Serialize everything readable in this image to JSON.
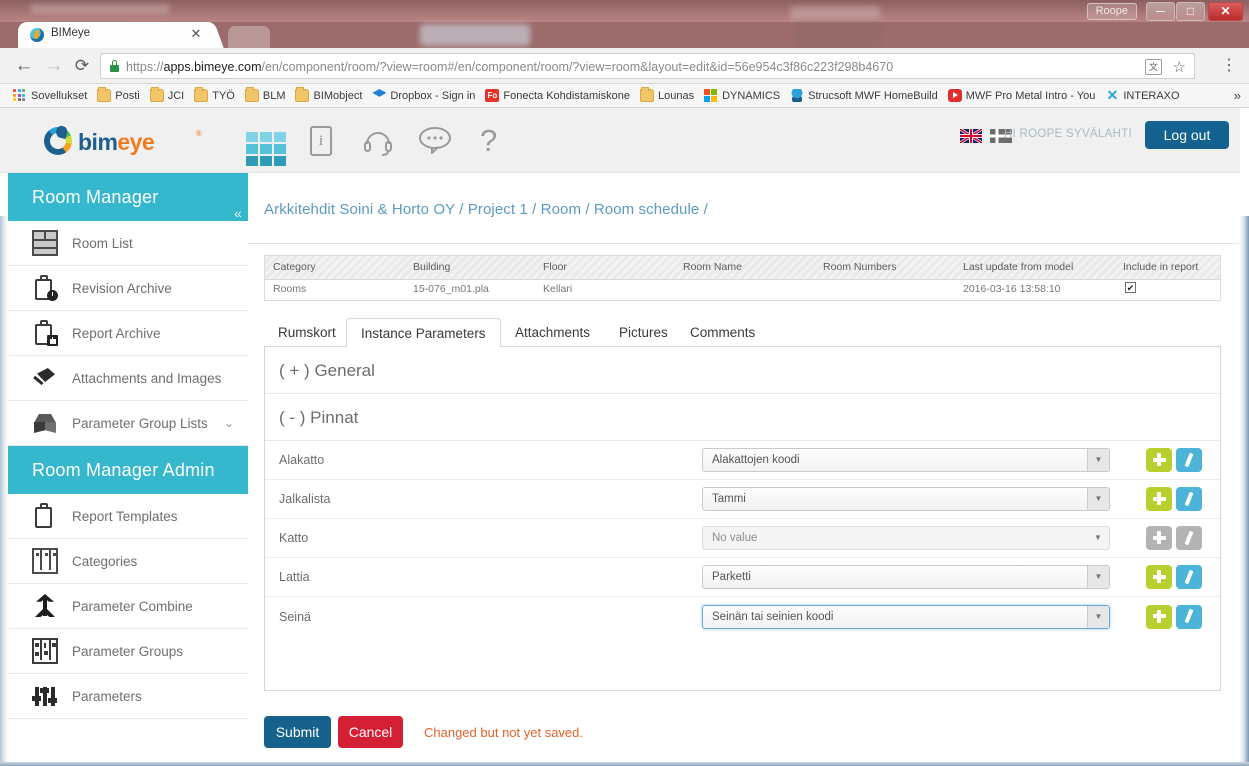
{
  "browser": {
    "tab": {
      "title": "BIMeye",
      "close_label": "✕"
    },
    "window_controls": {
      "user": "Roope",
      "minimize": "─",
      "maximize": "□",
      "close": "✕"
    },
    "nav": {
      "back": "←",
      "forward": "→",
      "reload": "⟳"
    },
    "omnibox": {
      "scheme": "https://",
      "host": "apps.bimeye.com",
      "path": "/en/component/room/?view=room#/en/component/room/?view=room&layout=edit&id=56e954c3f86c223f298b4670",
      "translate": "文",
      "star": "☆",
      "menu": "⋮"
    },
    "bookmarks": [
      {
        "label": "Sovellukset",
        "icon": "apps-grid-icon"
      },
      {
        "label": "Posti",
        "icon": "folder-icon"
      },
      {
        "label": "JCI",
        "icon": "folder-icon"
      },
      {
        "label": "TYÖ",
        "icon": "folder-icon"
      },
      {
        "label": "BLM",
        "icon": "folder-icon"
      },
      {
        "label": "BIMobject",
        "icon": "folder-icon"
      },
      {
        "label": "Dropbox - Sign in",
        "icon": "dropbox-icon"
      },
      {
        "label": "Fonecta Kohdistamiskone",
        "icon": "fonecta-icon"
      },
      {
        "label": "Lounas",
        "icon": "folder-icon"
      },
      {
        "label": "DYNAMICS",
        "icon": "microsoft-icon"
      },
      {
        "label": "Strucsoft MWF HomeBuild",
        "icon": "strucsoft-icon"
      },
      {
        "label": "MWF Pro Metal Intro - You",
        "icon": "youtube-icon"
      },
      {
        "label": "INTERAXO",
        "icon": "interaxo-icon"
      }
    ],
    "bookmarks_overflow": "»"
  },
  "app": {
    "logo": {
      "part1": "bim",
      "part2": "eye",
      "registered": "®"
    },
    "header_icons": [
      {
        "name": "apps-grid-icon"
      },
      {
        "name": "info-icon",
        "glyph": "i"
      },
      {
        "name": "support-headset-icon"
      },
      {
        "name": "chat-bubble-icon"
      },
      {
        "name": "help-question-icon",
        "glyph": "?"
      }
    ],
    "flags": [
      {
        "name": "flag-uk-icon"
      },
      {
        "name": "flag-se-icon"
      }
    ],
    "greeting": "HI ROOPE SYVÄLAHTI",
    "logout_label": "Log out",
    "accent_teal": "#35b7cd",
    "accent_blue": "#13628f",
    "accent_red": "#d51f35",
    "accent_green": "#b9cf2e",
    "accent_orange": "#e2622c"
  },
  "sidebar": {
    "sections": [
      {
        "title": "Room Manager",
        "collapse_glyph": "«",
        "items": [
          {
            "label": "Room List",
            "icon": "room-list-icon",
            "chevron": ""
          },
          {
            "label": "Revision Archive",
            "icon": "clipboard-clock-icon",
            "chevron": ""
          },
          {
            "label": "Report Archive",
            "icon": "clipboard-save-icon",
            "chevron": ""
          },
          {
            "label": "Attachments and Images",
            "icon": "pin-icon",
            "chevron": ""
          },
          {
            "label": "Parameter Group Lists",
            "icon": "cube-icon",
            "chevron": "⌄"
          }
        ]
      },
      {
        "title": "Room Manager Admin",
        "collapse_glyph": "",
        "items": [
          {
            "label": "Report Templates",
            "icon": "clipboard-icon",
            "chevron": ""
          },
          {
            "label": "Categories",
            "icon": "categories-icon",
            "chevron": ""
          },
          {
            "label": "Parameter Combine",
            "icon": "parameter-combine-icon",
            "chevron": ""
          },
          {
            "label": "Parameter Groups",
            "icon": "parameter-groups-icon",
            "chevron": ""
          },
          {
            "label": "Parameters",
            "icon": "parameters-sliders-icon",
            "chevron": ""
          }
        ]
      }
    ]
  },
  "main": {
    "breadcrumb": "Arkkitehdit Soini & Horto OY / Project 1 / Room / Room schedule /",
    "summary_table": {
      "columns": [
        "Category",
        "Building",
        "Floor",
        "Room Name",
        "Room Numbers",
        "Last update from model",
        "Include in report"
      ],
      "row": {
        "category": "Rooms",
        "building": "15-076_m01.pla",
        "floor": "Kellari",
        "room_name": "",
        "room_numbers": "",
        "last_update": "2016-03-16 13:58:10",
        "include_in_report": true,
        "check_glyph": "✔"
      }
    },
    "tabs": [
      {
        "label": "Rumskort",
        "active": false
      },
      {
        "label": "Instance Parameters",
        "active": true
      },
      {
        "label": "Attachments",
        "active": false
      },
      {
        "label": "Pictures",
        "active": false
      },
      {
        "label": "Comments",
        "active": false
      }
    ],
    "groups": [
      {
        "toggle": "( + )",
        "name": "General",
        "expanded": false
      },
      {
        "toggle": "( - )",
        "name": "Pinnat",
        "expanded": true
      }
    ],
    "parameters": [
      {
        "label": "Alakatto",
        "value": "Alakattojen koodi",
        "disabled": false,
        "focused": false,
        "arrow": "▼"
      },
      {
        "label": "Jalkalista",
        "value": "Tammi",
        "disabled": false,
        "focused": false,
        "arrow": "▼"
      },
      {
        "label": "Katto",
        "value": "No value",
        "disabled": true,
        "focused": false,
        "arrow": "▼"
      },
      {
        "label": "Lattia",
        "value": "Parketti",
        "disabled": false,
        "focused": false,
        "arrow": "▼"
      },
      {
        "label": "Seinä",
        "value": "Seinän tai seinien koodi",
        "disabled": false,
        "focused": true,
        "arrow": "▼"
      }
    ],
    "footer": {
      "submit_label": "Submit",
      "cancel_label": "Cancel",
      "status": "Changed but not yet saved."
    }
  }
}
